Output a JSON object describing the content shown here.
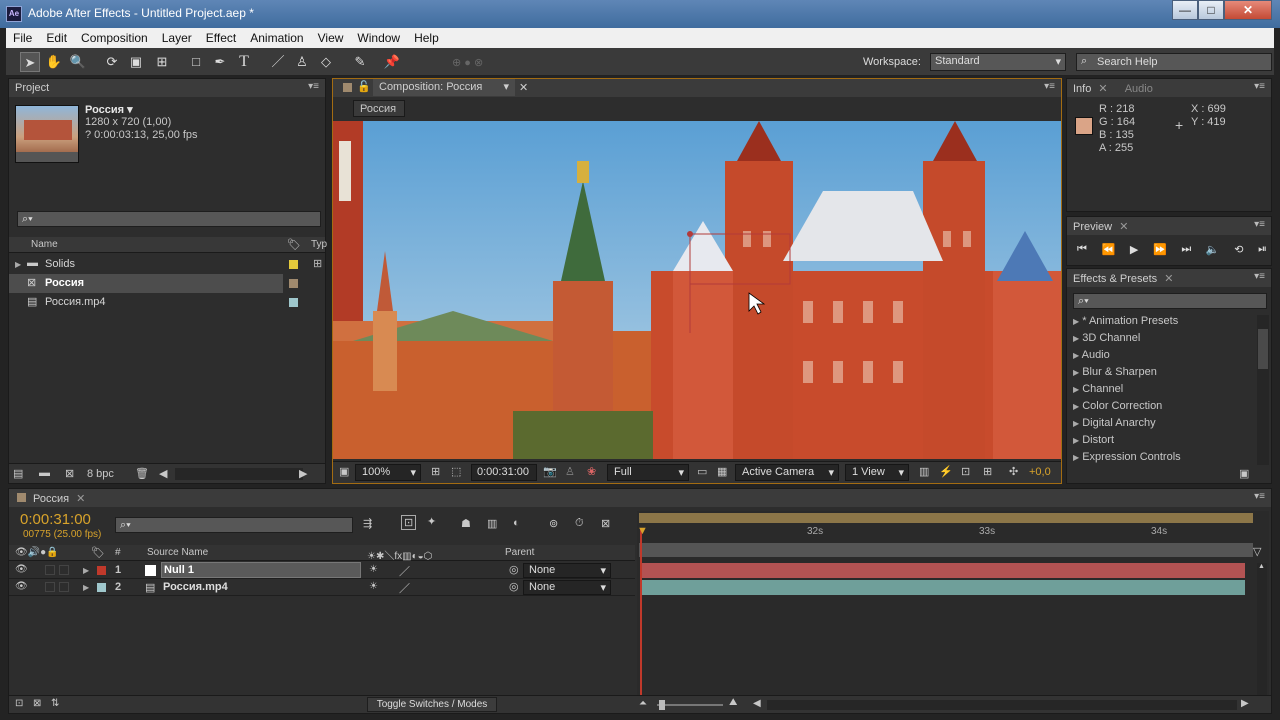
{
  "window": {
    "title": "Adobe After Effects - Untitled Project.aep *",
    "icon": "Ae",
    "minimize": "—",
    "maximize": "□",
    "close": "✕"
  },
  "menu": [
    "File",
    "Edit",
    "Composition",
    "Layer",
    "Effect",
    "Animation",
    "View",
    "Window",
    "Help"
  ],
  "toolbar": {
    "workspace_label": "Workspace:",
    "workspace_value": "Standard",
    "search_placeholder": "Search Help"
  },
  "project": {
    "tab": "Project",
    "comp_name": "Россия ▾",
    "comp_size": "1280 x 720 (1,00)",
    "comp_duration": "? 0:00:03:13, 25,00 fps",
    "col_name": "Name",
    "col_type": "Typ",
    "items": [
      {
        "name": "Solids",
        "color": "#e3c93b"
      },
      {
        "name": "Россия",
        "color": "#a08a6e"
      },
      {
        "name": "Россия.mp4",
        "color": "#9fc7cc"
      }
    ],
    "bpc": "8 bpc"
  },
  "composition": {
    "tab": "Composition: Россия",
    "sub_tab": "Россия",
    "zoom": "100%",
    "timecode": "0:00:31:00",
    "resolution": "Full",
    "camera": "Active Camera",
    "views": "1 View",
    "exposure": "+0,0"
  },
  "info": {
    "tab": "Info",
    "tab2": "Audio",
    "r": "R : 218",
    "g": "G : 164",
    "b": "B : 135",
    "a": "A : 255",
    "x": "X : 699",
    "y": "Y : 419",
    "swatch": "#daa487"
  },
  "preview": {
    "tab": "Preview"
  },
  "effects": {
    "tab": "Effects & Presets",
    "items": [
      "* Animation Presets",
      "3D Channel",
      "Audio",
      "Blur & Sharpen",
      "Channel",
      "Color Correction",
      "Digital Anarchy",
      "Distort",
      "Expression Controls"
    ]
  },
  "timeline": {
    "tab": "Россия",
    "timecode": "0:00:31:00",
    "frame": "00775 (25.00 fps)",
    "col_hash": "#",
    "col_source": "Source Name",
    "col_parent": "Parent",
    "ruler": [
      "32s",
      "33s",
      "34s"
    ],
    "layers": [
      {
        "num": "1",
        "name": "Null 1",
        "parent": "None",
        "label": "#c0392b",
        "bar": "#b35353"
      },
      {
        "num": "2",
        "name": "Россия.mp4",
        "parent": "None",
        "label": "#9fc7cc",
        "bar": "#6f9f9a"
      }
    ],
    "toggle": "Toggle Switches / Modes"
  }
}
